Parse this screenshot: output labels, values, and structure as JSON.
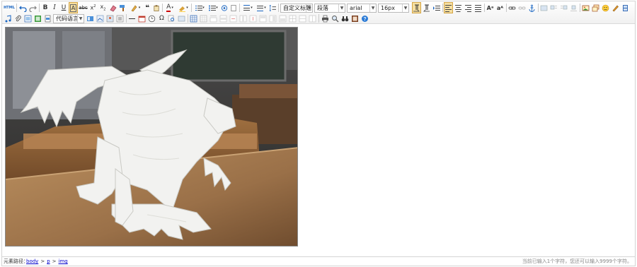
{
  "toolbar": {
    "code_language_label": "代码语言",
    "heading_label": "自定义标题",
    "paragraph_label": "段落",
    "font_family_label": "arial",
    "font_size_label": "16px",
    "html_label": "HTML"
  },
  "statusbar": {
    "path_label": "元素路径：",
    "crumbs": [
      "body",
      "p",
      "img"
    ],
    "crumb_separator": ">",
    "word_count": "当前已输入1个字符，您还可以输入9999个字符。"
  },
  "colors": {
    "accent_active": "#f6dfa1",
    "link": "#0000cc"
  }
}
